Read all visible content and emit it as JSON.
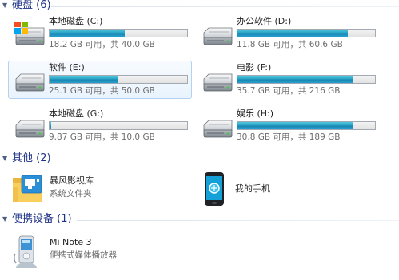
{
  "groups": {
    "hard_drives": "硬盘 (6)",
    "other": "其他 (2)",
    "portable": "便携设备 (1)"
  },
  "drives": [
    {
      "name": "本地磁盘 (C:)",
      "space": "18.2 GB 可用，共 40.0 GB",
      "used_fraction": 0.545,
      "icon": "windows-drive-icon"
    },
    {
      "name": "办公软件 (D:)",
      "space": "11.8 GB 可用，共 60.6 GB",
      "used_fraction": 0.805,
      "icon": "hard-drive-icon"
    },
    {
      "name": "软件 (E:)",
      "space": "25.1 GB 可用，共 50.0 GB",
      "used_fraction": 0.498,
      "icon": "hard-drive-icon"
    },
    {
      "name": "电影 (F:)",
      "space": "35.7 GB 可用，共 216 GB",
      "used_fraction": 0.835,
      "icon": "hard-drive-icon"
    },
    {
      "name": "本地磁盘 (G:)",
      "space": "9.87 GB 可用，共 10.0 GB",
      "used_fraction": 0.013,
      "icon": "hard-drive-icon"
    },
    {
      "name": "娱乐 (H:)",
      "space": "30.8 GB 可用，共 189 GB",
      "used_fraction": 0.837,
      "icon": "hard-drive-icon"
    }
  ],
  "other_items": [
    {
      "name": "暴风影视库",
      "subtitle": "系统文件夹",
      "icon": "media-library-folder-icon"
    },
    {
      "name": "我的手机",
      "subtitle": "",
      "icon": "mobile-phone-icon"
    }
  ],
  "portable_items": [
    {
      "name": "Mi Note 3",
      "subtitle": "便携式媒体播放器",
      "icon": "media-player-device-icon"
    }
  ],
  "colors": {
    "group_title": "#1e3287",
    "bar_fill": "#26a0c4",
    "selection": "#e9f3fd",
    "secondary_text": "#6d6d6d"
  }
}
